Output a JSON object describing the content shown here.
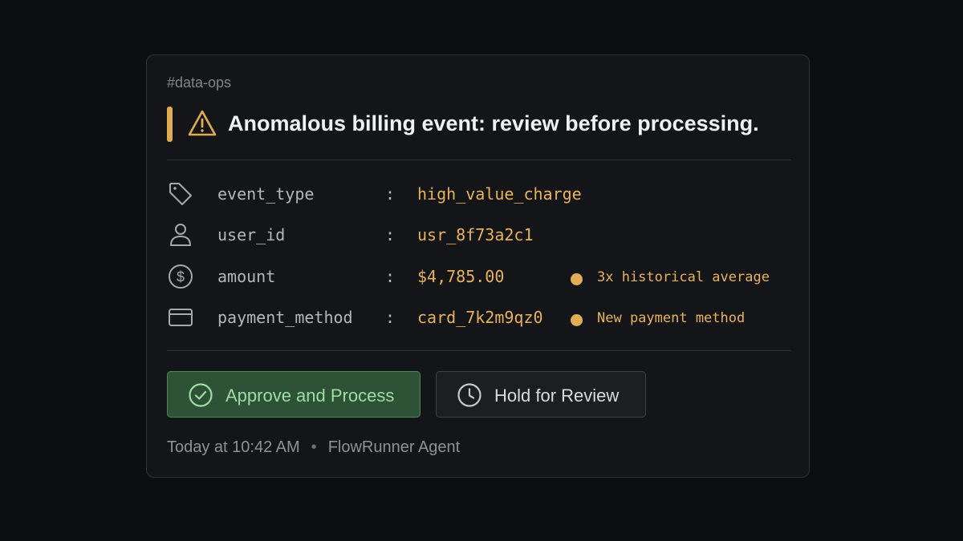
{
  "message": {
    "channel": "#data-ops",
    "title": "Anomalous billing event: review before processing.",
    "alert_icon": "warning-triangle-icon",
    "accent_color": "#e0ac52"
  },
  "fields": [
    {
      "icon": "tag-icon",
      "key": "event_type",
      "separator": ":",
      "value": "high_value_charge",
      "flag": null
    },
    {
      "icon": "user-icon",
      "key": "user_id",
      "separator": ":",
      "value": "usr_8f73a2c1",
      "flag": null
    },
    {
      "icon": "dollar-circle-icon",
      "key": "amount",
      "separator": ":",
      "value": "$4,785.00",
      "flag": "3x historical average"
    },
    {
      "icon": "credit-card-icon",
      "key": "payment_method",
      "separator": ":",
      "value": "card_7k2m9qz0",
      "flag": "New payment method"
    }
  ],
  "actions": {
    "approve": {
      "label": "Approve and Process",
      "icon": "check-circle-icon",
      "color": "#2d5236"
    },
    "hold": {
      "label": "Hold for Review",
      "icon": "clock-icon"
    }
  },
  "footer": {
    "timestamp": "Today at 10:42 AM",
    "separator": "•",
    "author": "FlowRunner Agent"
  }
}
